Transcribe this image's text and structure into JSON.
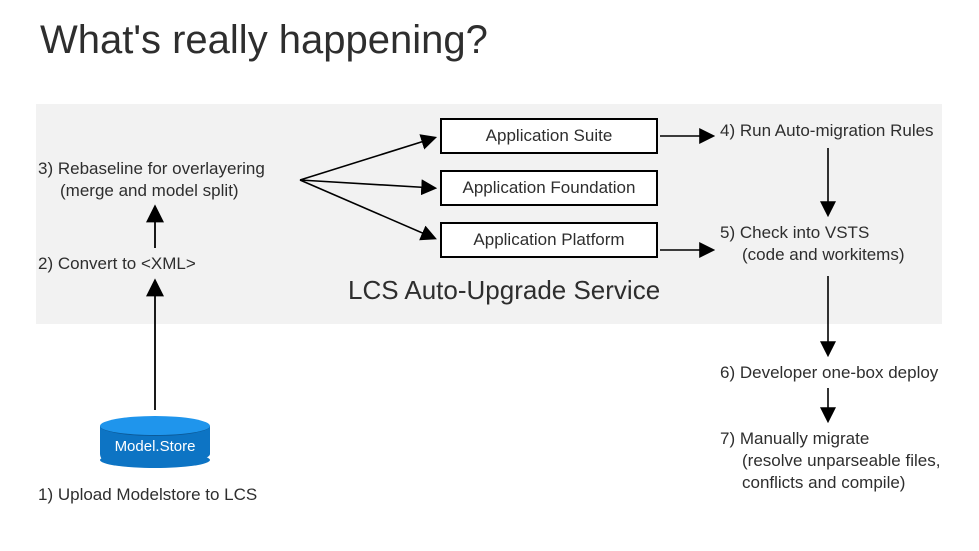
{
  "title": "What's really happening?",
  "boxes": {
    "suite": "Application Suite",
    "foundation": "Application Foundation",
    "platform": "Application Platform"
  },
  "lcs_label": "LCS Auto-Upgrade Service",
  "cylinder_label": "Model.Store",
  "steps": {
    "s1": "1) Upload Modelstore to LCS",
    "s2": "2) Convert to <XML>",
    "s3a": "3) Rebaseline for overlayering",
    "s3b": "(merge and model split)",
    "s4": "4) Run Auto-migration Rules",
    "s5a": "5) Check into VSTS",
    "s5b": "(code and workitems)",
    "s6": "6) Developer one-box deploy",
    "s7a": "7) Manually migrate",
    "s7b": "(resolve unparseable files,",
    "s7c": "conflicts and compile)"
  }
}
